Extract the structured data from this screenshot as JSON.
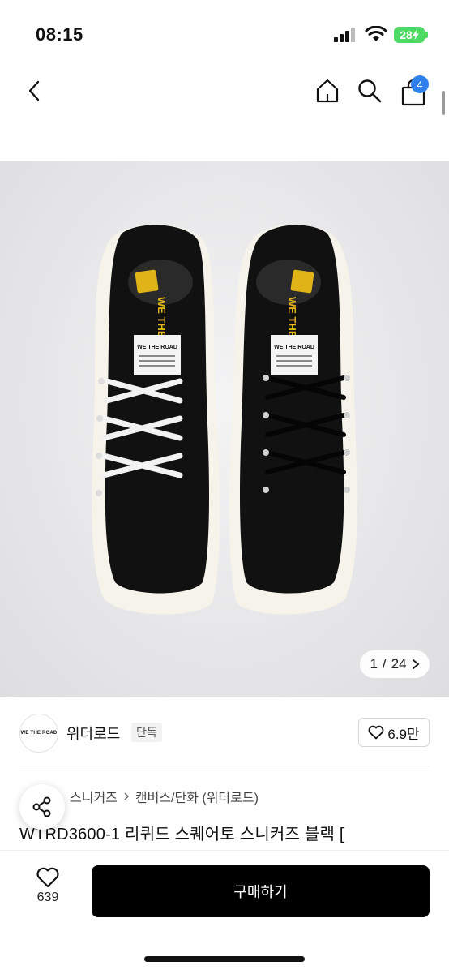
{
  "status_bar": {
    "time": "08:15",
    "battery": "28"
  },
  "nav": {
    "cart_count": "4"
  },
  "image_counter": {
    "current": "1",
    "separator": "/",
    "total": "24"
  },
  "shoe_labels": {
    "tag_title": "WE THE ROAD",
    "side_text": "WE THE"
  },
  "brand": {
    "logo_text": "WE THE ROAD",
    "name": "위더로드",
    "exclusive": "단독",
    "likes": "6.9만"
  },
  "category": {
    "level1": "스니커즈",
    "level2": "캔버스/단화 (위더로드)"
  },
  "product": {
    "title": "WTRD3600-1 리퀴드 스퀘어토 스니커즈 블랙 ["
  },
  "bottom": {
    "wishlist_count": "639",
    "buy_label": "구매하기"
  },
  "colors": {
    "accent": "#2f80ed",
    "buy_button": "#000000",
    "battery": "#4cd964"
  }
}
